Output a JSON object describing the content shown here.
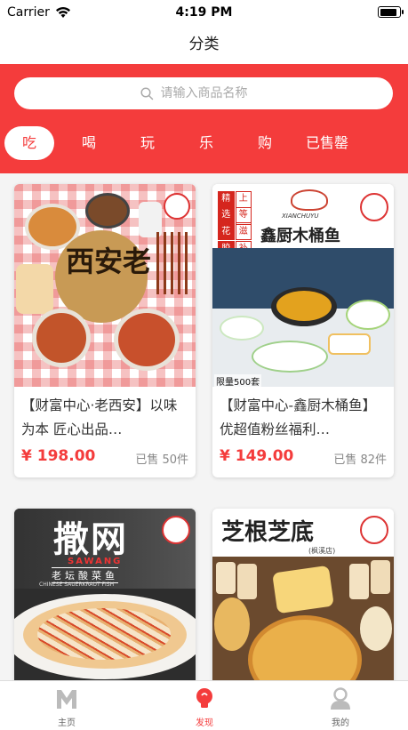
{
  "status": {
    "carrier": "Carrier",
    "time": "4:19 PM"
  },
  "nav": {
    "title": "分类"
  },
  "search": {
    "placeholder": "请输入商品名称"
  },
  "tabs": [
    {
      "label": "吃",
      "active": true
    },
    {
      "label": "喝"
    },
    {
      "label": "玩"
    },
    {
      "label": "乐"
    },
    {
      "label": "购"
    },
    {
      "label": "已售罄"
    }
  ],
  "products": [
    {
      "title": "【财富中心·老西安】以味为本 匠心出品…",
      "price": "¥ 198.00",
      "sold": "已售 50件",
      "image_text": "西安老"
    },
    {
      "title": "【财富中心-鑫厨木桶鱼】优超值粉丝福利…",
      "price": "¥ 149.00",
      "sold": "已售 82件",
      "image_text": "鑫厨木桶鱼",
      "image_tag": "限量500套",
      "image_badge": [
        "精",
        "上",
        "选",
        "等",
        "花",
        "滋",
        "胶",
        "补"
      ],
      "image_brand": "XIANCHUYU"
    },
    {
      "title": "",
      "price": "",
      "sold": "",
      "image_text": "撒网",
      "image_sub": "SAWANG",
      "image_sub2": "老坛酸菜鱼",
      "image_sub3": "CHINESE SAUERKRAUT FISH"
    },
    {
      "title": "",
      "price": "",
      "sold": "",
      "image_text": "芝根芝底",
      "image_sub": "(枫溪店)"
    }
  ],
  "tabbar": [
    {
      "label": "主页",
      "icon": "home-m-icon"
    },
    {
      "label": "发现",
      "icon": "discover-bulb-icon",
      "active": true
    },
    {
      "label": "我的",
      "icon": "profile-icon"
    }
  ],
  "colors": {
    "accent": "#f43c3c"
  }
}
